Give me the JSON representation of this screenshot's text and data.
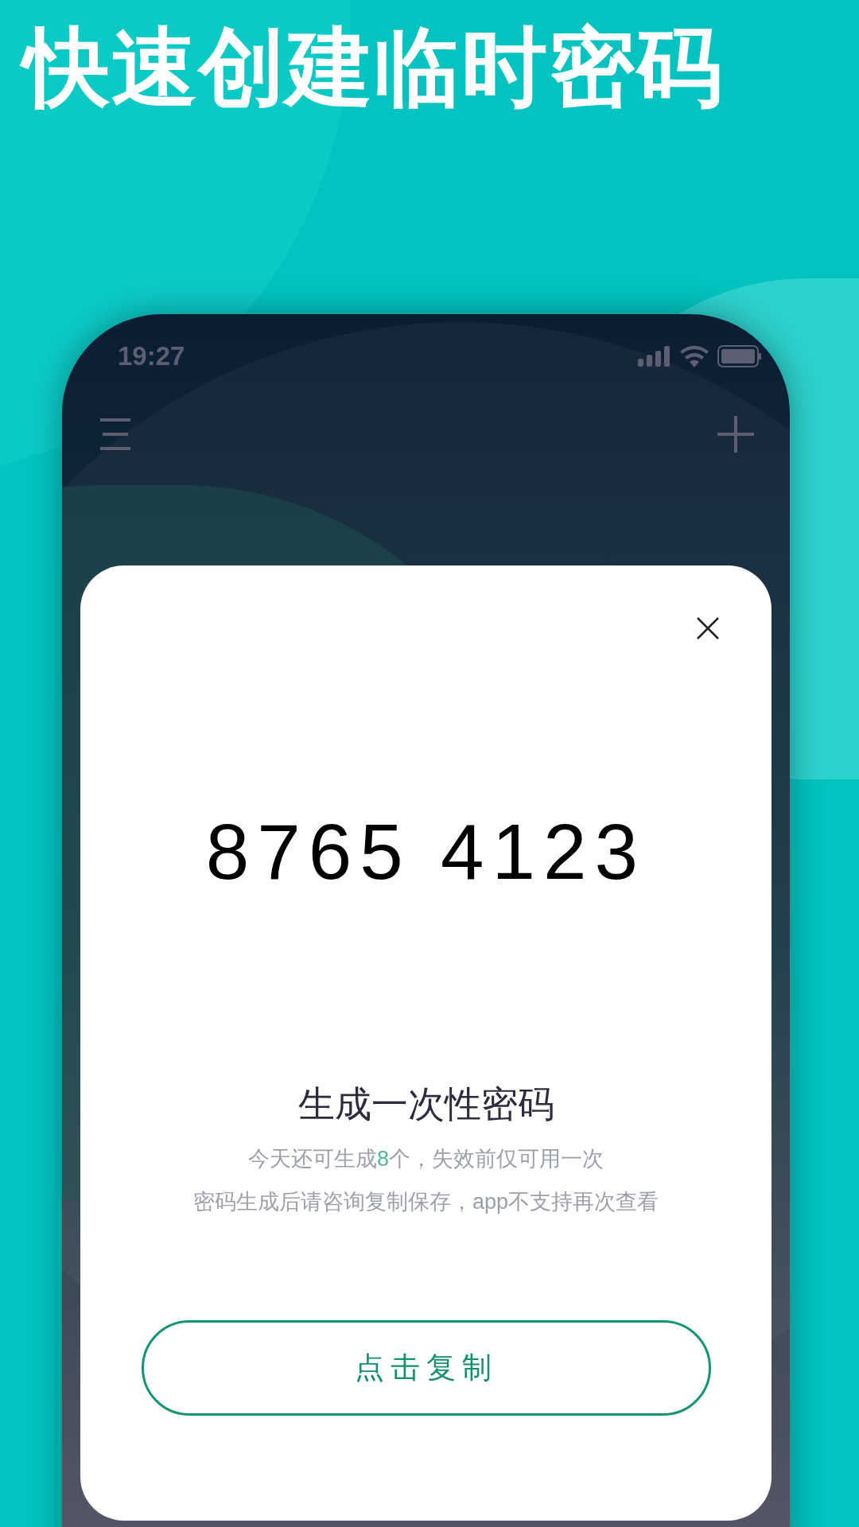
{
  "headline": "快速创建临时密码",
  "status_bar": {
    "time": "19:27"
  },
  "dialog": {
    "code": "8765 4123",
    "title": "生成一次性密码",
    "notice": [
      {
        "segments": [
          {
            "text": "今天还可生成",
            "highlight": false
          },
          {
            "text": "8",
            "highlight": true
          },
          {
            "text": "个，失效前仅可用一次",
            "highlight": false
          }
        ]
      },
      {
        "segments": [
          {
            "text": "密码生成后请咨询复制保存，app不支持再次查看",
            "highlight": false
          }
        ]
      }
    ],
    "button": "点击复制"
  }
}
